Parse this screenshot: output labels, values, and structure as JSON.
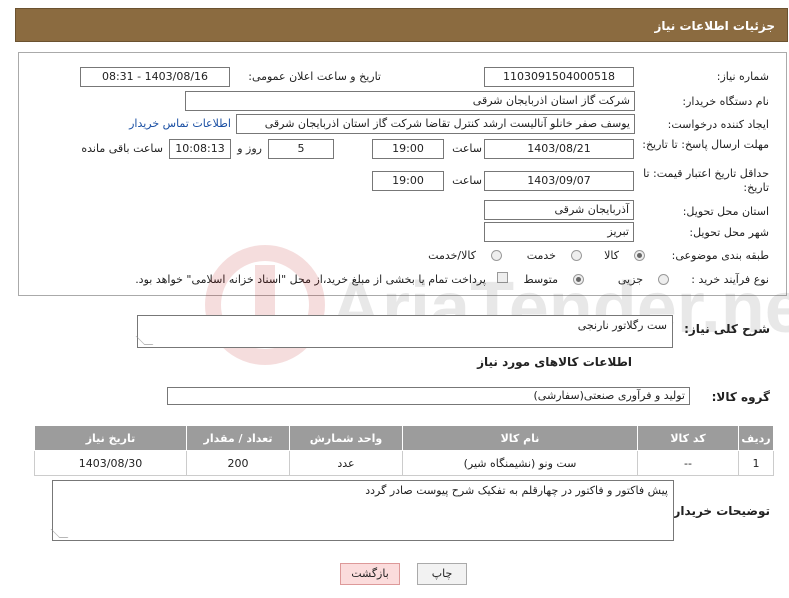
{
  "header": {
    "title": "جزئیات اطلاعات نیاز"
  },
  "form": {
    "need_number_label": "شماره نیاز:",
    "need_number": "1103091504000518",
    "announce_label": "تاریخ و ساعت اعلان عمومی:",
    "announce_value": "1403/08/16 - 08:31",
    "buyer_label": "نام دستگاه خریدار:",
    "buyer_value": "شرکت گاز استان اذربایجان شرقی",
    "creator_label": "ایجاد کننده درخواست:",
    "creator_value": "یوسف صفر خانلو  آنالیست ارشد کنترل تقاضا  شرکت گاز استان اذربایجان شرقی",
    "contact_link": "اطلاعات تماس خریدار",
    "deadline_label": "مهلت ارسال پاسخ: تا تاریخ:",
    "deadline_date": "1403/08/21",
    "time_label": "ساعت",
    "deadline_time": "19:00",
    "days_value": "5",
    "days_label": "روز و",
    "remaining_time": "10:08:13",
    "remaining_label": "ساعت باقی مانده",
    "validity_label": "حداقل تاریخ اعتبار قیمت: تا تاریخ:",
    "validity_date": "1403/09/07",
    "validity_time": "19:00",
    "province_label": "استان محل تحویل:",
    "province_value": "آذربایجان شرقی",
    "city_label": "شهر محل تحویل:",
    "city_value": "تبریز",
    "category_label": "طبقه بندی موضوعی:",
    "category_options": [
      "کالا",
      "خدمت",
      "کالا/خدمت"
    ],
    "category_selected": "کالا",
    "process_label": "نوع فرآیند خرید :",
    "process_options": [
      "جزیی",
      "متوسط"
    ],
    "process_selected": "متوسط",
    "payment_note": "پرداخت تمام یا بخشی از مبلغ خرید،از محل \"اسناد خزانه اسلامی\" خواهد بود."
  },
  "description": {
    "label": "شرح کلی نیاز:",
    "value": "ست رگلاتور نارنجی"
  },
  "goods_section": {
    "title": "اطلاعات کالاهای مورد نیاز"
  },
  "goods_group": {
    "label": "گروه کالا:",
    "value": "تولید و فرآوری صنعتی(سفارشی)"
  },
  "table": {
    "headers": [
      "ردیف",
      "کد کالا",
      "نام کالا",
      "واحد شمارش",
      "تعداد / مقدار",
      "تاریخ نیاز"
    ],
    "rows": [
      [
        "1",
        "--",
        "ست ونو (نشیمنگاه شیر)",
        "عدد",
        "200",
        "1403/08/30"
      ]
    ]
  },
  "buyer_notes": {
    "label": "توضیحات خریدار:",
    "value": "پیش فاکتور و فاکتور در چهارقلم به تفکیک شرح پیوست صادر گردد"
  },
  "buttons": {
    "print": "چاپ",
    "back": "بازگشت"
  },
  "colors": {
    "header_bg": "#8b6b40",
    "table_header_bg": "#9c9c9c",
    "link": "#1a4fa3",
    "back_button_bg": "#fbdcdc"
  },
  "watermark_text": "AriaTender.net"
}
